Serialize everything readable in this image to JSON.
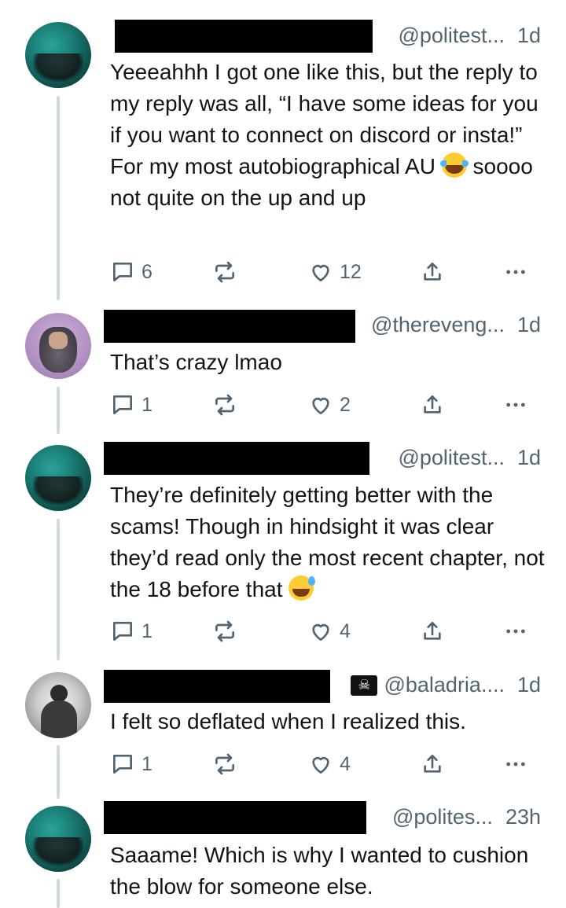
{
  "posts": [
    {
      "handle": "@politest...",
      "time": "1d",
      "avatar": "teal-avatar",
      "text_parts": [
        "Yeeeahhh I got one like this, but the reply to my reply was all, “I have some ideas for you if you want to connect on discord or insta!” For my most autobiographical AU",
        "soooo not quite on the up and up"
      ],
      "emoji": "face-with-tears-of-joy-icon",
      "replies": "6",
      "likes": "12"
    },
    {
      "handle": "@thereveng...",
      "time": "1d",
      "avatar": "bearded-man-avatar",
      "text": "That’s crazy lmao",
      "replies": "1",
      "likes": "2"
    },
    {
      "handle": "@politest...",
      "time": "1d",
      "avatar": "teal-avatar",
      "text": "They’re definitely getting better with the scams! Though in hindsight it was clear they’d read only the most recent chapter, not the 18 before that",
      "emoji": "grinning-face-with-sweat-icon",
      "replies": "1",
      "likes": "4"
    },
    {
      "handle": "@baladria....",
      "time": "1d",
      "avatar": "bw-photo-avatar",
      "badge": "pirate-flag-icon",
      "text": "I felt so deflated when I realized this.",
      "replies": "1",
      "likes": "4"
    },
    {
      "handle": "@polites...",
      "time": "23h",
      "avatar": "teal-avatar",
      "text": "Saaame! Which is why I wanted to cushion the blow for someone else."
    }
  ],
  "colors": {
    "text": "#0f1419",
    "muted": "#536471",
    "thread": "#cfd9de",
    "redaction": "#000000"
  }
}
